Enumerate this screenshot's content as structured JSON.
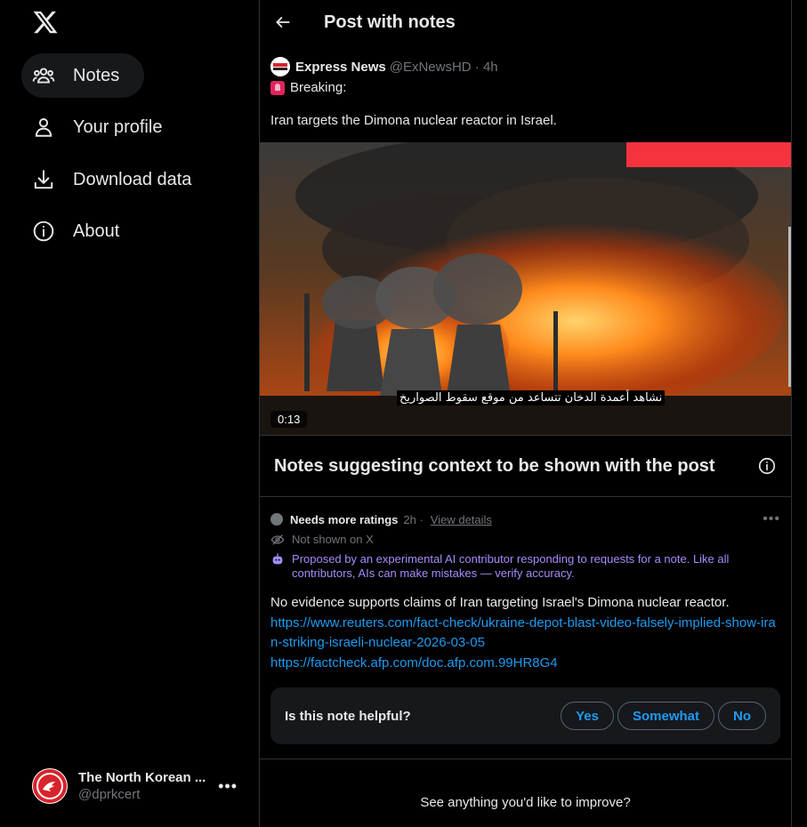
{
  "sidebar": {
    "items": [
      {
        "label": "Notes",
        "icon": "people-icon"
      },
      {
        "label": "Your profile",
        "icon": "person-icon"
      },
      {
        "label": "Download data",
        "icon": "download-icon"
      },
      {
        "label": "About",
        "icon": "info-icon"
      }
    ],
    "account": {
      "name": "The North Korean ...",
      "handle": "@dprkcert"
    }
  },
  "header": {
    "title": "Post with notes"
  },
  "post": {
    "author": "Express News",
    "handle": "@ExNewsHD · 4h",
    "line1": "Breaking:",
    "line2": "Iran targets the Dimona nuclear reactor in Israel.",
    "video_subtitle": "نشاهد أعمدة الدخان تتساعد من موقع سقوط الصواريخ",
    "video_time": "0:13"
  },
  "notes_section": {
    "title": "Notes suggesting context to be shown with the post"
  },
  "note": {
    "status": "Needs more ratings",
    "time": "2h ·",
    "view_details": "View details",
    "not_shown": "Not shown on X",
    "ai_notice": "Proposed by an experimental AI contributor responding to requests for a note. Like all contributors, AIs can make mistakes — verify accuracy.",
    "body": "No evidence supports claims of Iran targeting Israel's Dimona nuclear reactor.",
    "links": [
      "https://www.reuters.com/fact-check/ukraine-depot-blast-video-falsely-implied-show-iran-striking-israeli-nuclear-2026-03-05",
      "https://factcheck.afp.com/doc.afp.com.99HR8G4"
    ]
  },
  "helpful": {
    "question": "Is this note helpful?",
    "yes": "Yes",
    "somewhat": "Somewhat",
    "no": "No"
  },
  "improve": {
    "text": "See anything you'd like to improve?"
  },
  "colors": {
    "accent": "#1d9bf0",
    "ai_purple": "#a78bfa",
    "background": "#000000",
    "muted": "#71767b"
  }
}
